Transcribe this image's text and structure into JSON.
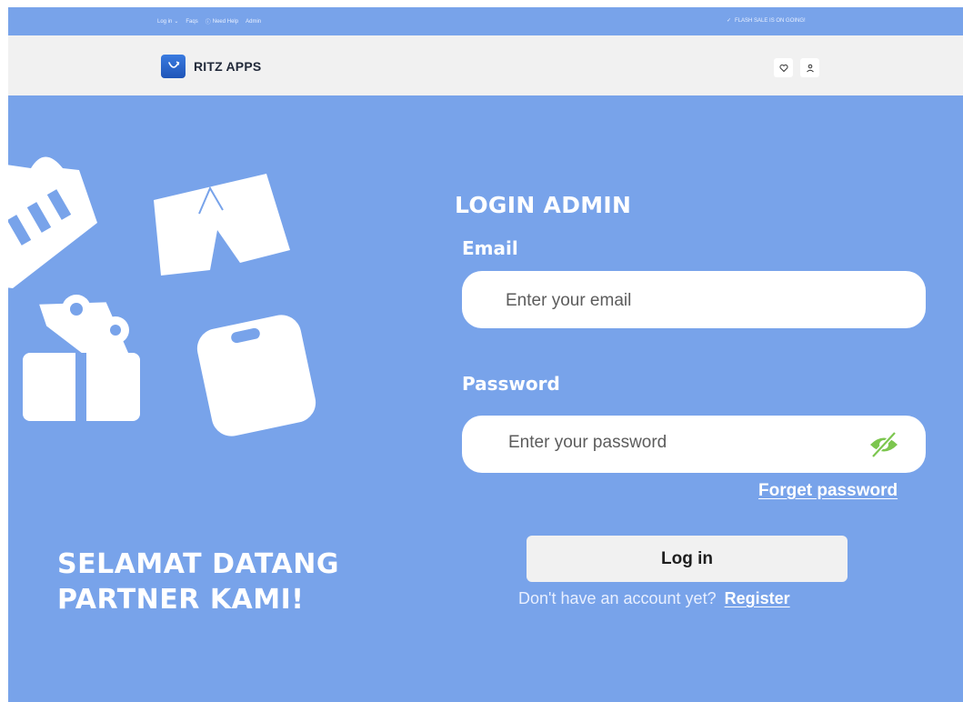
{
  "topbar": {
    "login_label": "Log in",
    "faqs_label": "Faqs",
    "help_label": "Need Help",
    "admin_label": "Admin",
    "flash_text": "FLASH SALE IS ON GOING!"
  },
  "header": {
    "brand": "RITZ APPS"
  },
  "welcome": {
    "line1": "SELAMAT DATANG",
    "line2": "PARTNER KAMI!"
  },
  "form": {
    "title": "LOGIN ADMIN",
    "email_label": "Email",
    "email_placeholder": "Enter your email",
    "password_label": "Password",
    "password_placeholder": "Enter your password",
    "forget_label": "Forget password",
    "login_button": "Log in",
    "no_account_text": "Don't have an account yet?",
    "register_label": "Register"
  },
  "icons": {
    "eye": "eye-off-icon",
    "heart": "heart-icon",
    "user": "user-icon",
    "check": "check-icon",
    "help": "help-circle-icon",
    "chevron": "chevron-down-icon"
  },
  "colors": {
    "background": "#78a3ea",
    "header": "#f1f1f1",
    "eye_icon": "#7cc64f"
  }
}
